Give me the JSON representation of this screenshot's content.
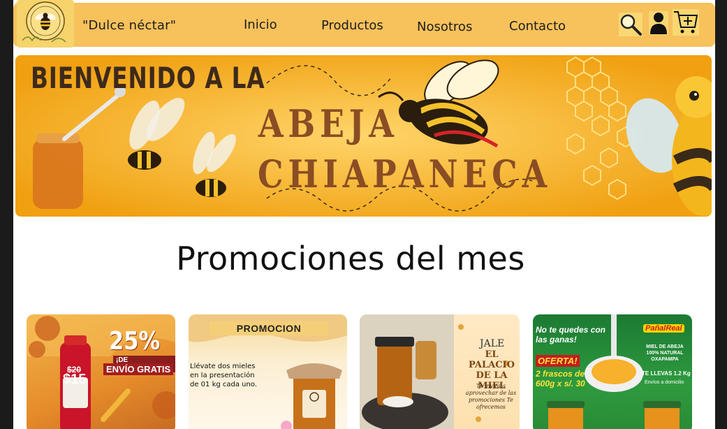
{
  "header": {
    "logo_icon": "bee-logo-icon",
    "brand_label": "\"Dulce néctar\"",
    "nav": [
      {
        "label": "Inicio"
      },
      {
        "label": "Productos"
      },
      {
        "label": "Nosotros"
      },
      {
        "label": "Contacto"
      }
    ],
    "icons": [
      "search-icon",
      "user-icon",
      "cart-icon"
    ]
  },
  "banner": {
    "title": "BIENVENIDO A LA",
    "line1": "ABEJA",
    "line2": "CHIAPANECA"
  },
  "promotions": {
    "title": "Promociones del mes",
    "cards": [
      {
        "discount": "25%",
        "discount_label": "¡DE DESCUENTO!",
        "shipping": "ENVÍO GRATIS",
        "old_price": "$20",
        "new_price": "$15"
      },
      {
        "heading": "PROMOCION",
        "body": "Llévate dos mieles en la presentación de 01 kg cada uno."
      },
      {
        "line1": "JALE",
        "line2": "EL PALACIO DE LA MIEL",
        "line3": "Te invita a aprovechar de las promociones Te ofrecemos"
      },
      {
        "headline": "No te quedes con las ganas!",
        "offer": "OFERTA!",
        "offer_detail": "2 frascos de 600g x s/. 30",
        "brand": "PañalReal",
        "tagline": "MIEL DE ABEJA 100% NATURAL OXAPAMPA",
        "take": "TE LLEVAS 1.2 Kg",
        "delivery": "Envíos a domicilio"
      }
    ]
  },
  "colors": {
    "navbar": "#f7c15c",
    "banner": "#f7b322",
    "text": "#111111"
  }
}
